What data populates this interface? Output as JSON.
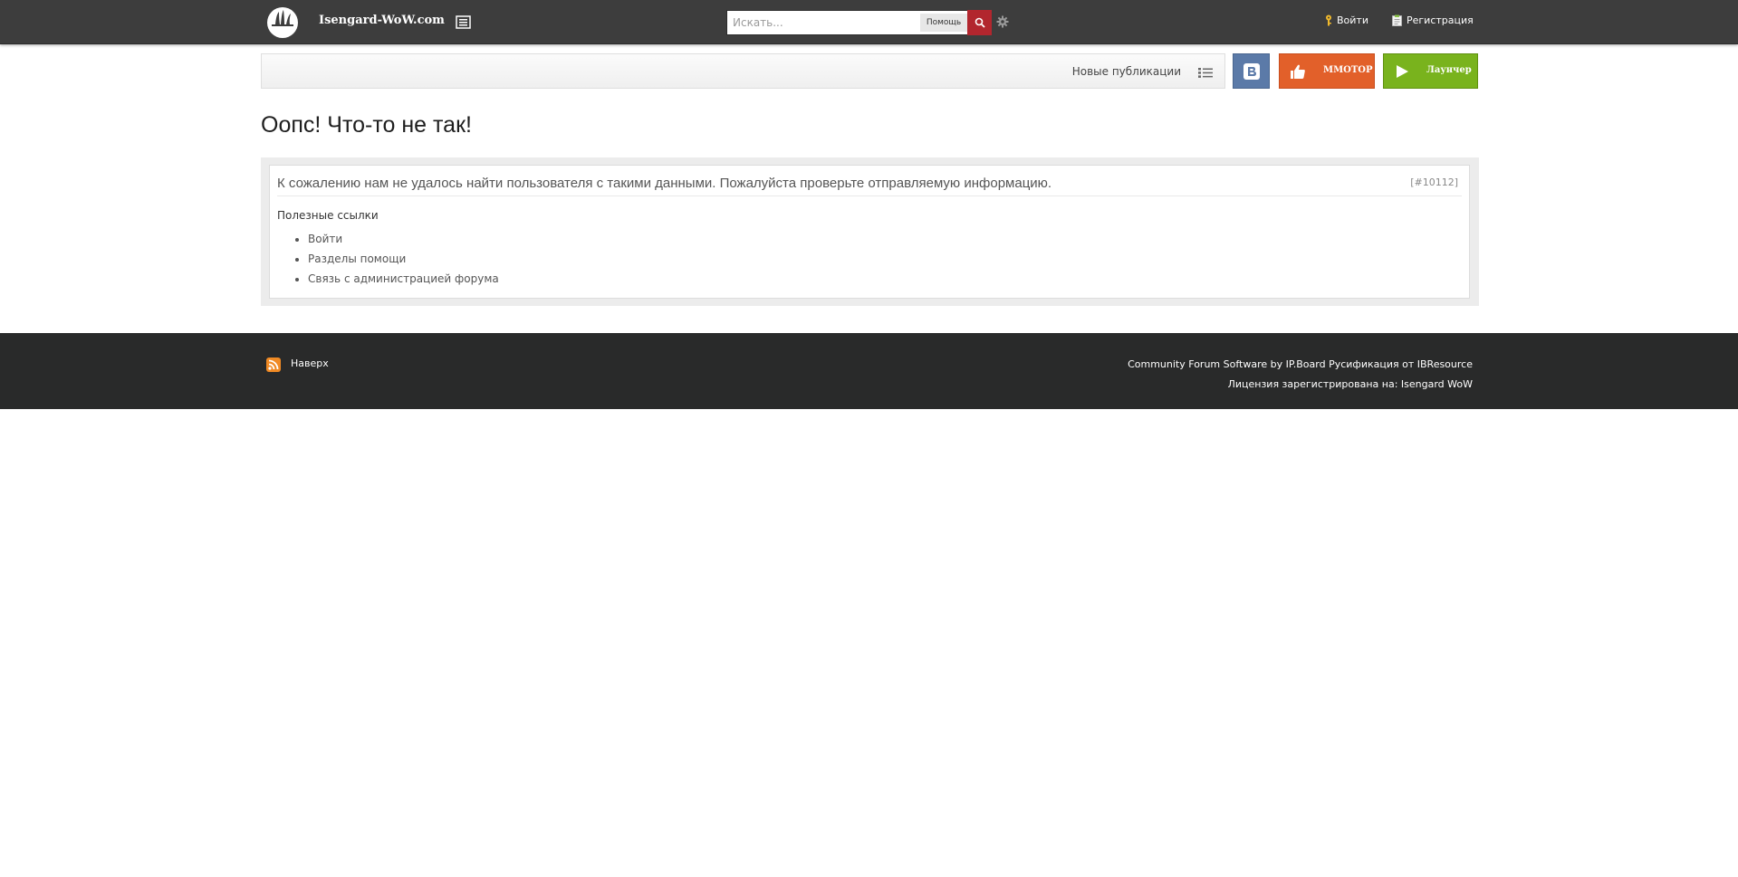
{
  "header": {
    "site_name": "Isengard-WoW.com",
    "search": {
      "placeholder": "Искать...",
      "scope_label": "Помощь"
    },
    "login_label": "Войти",
    "register_label": "Регистрация"
  },
  "navbar": {
    "new_posts_label": "Новые публикации",
    "mmotop_label": "MMOTOP",
    "launcher_label": "Лаунчер"
  },
  "main": {
    "title": "Оопс! Что-то не так!",
    "error_message": "К сожалению нам не удалось найти пользователя с такими данными. Пожалуйста проверьте отправляемую информацию.",
    "error_code": "[#10112]",
    "useful_links_title": "Полезные ссылки",
    "links": [
      {
        "label": "Войти"
      },
      {
        "label": "Разделы помощи"
      },
      {
        "label": "Связь с администрацией форума"
      }
    ]
  },
  "footer": {
    "back_to_top": "Наверх",
    "copyright": "Community Forum Software by IP.Board Русификация от IBResource",
    "license": "Лицензия зарегистрирована на: Isengard WoW"
  },
  "colors": {
    "topbar": "#3d3d3d",
    "search_button": "#b2262e",
    "vk": "#5b7aa8",
    "mmotop": "#e2602a",
    "launcher": "#79b31d",
    "footer": "#292a2a"
  }
}
